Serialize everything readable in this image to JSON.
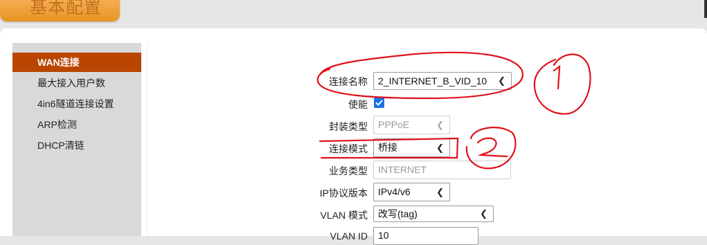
{
  "header": {
    "tab_title": "基本配置"
  },
  "sidebar": {
    "items": [
      {
        "label": "WAN连接",
        "active": true
      },
      {
        "label": "最大接入用户数",
        "active": false
      },
      {
        "label": "4in6隧道连接设置",
        "active": false
      },
      {
        "label": "ARP检测",
        "active": false
      },
      {
        "label": "DHCP清链",
        "active": false
      }
    ]
  },
  "form": {
    "connection_name": {
      "label": "连接名称",
      "value": "2_INTERNET_B_VID_10",
      "icon": "chevron-down-icon"
    },
    "enable": {
      "label": "使能",
      "checked": true,
      "icon": "checkmark-icon"
    },
    "encapsulation": {
      "label": "封装类型",
      "value": "PPPoE",
      "disabled": true,
      "icon": "chevron-down-icon"
    },
    "connection_mode": {
      "label": "连接模式",
      "value": "桥接",
      "icon": "chevron-down-icon"
    },
    "service_type": {
      "label": "业务类型",
      "value": "INTERNET",
      "disabled": true
    },
    "ip_version": {
      "label": "IP协议版本",
      "value": "IPv4/v6",
      "icon": "chevron-down-icon"
    },
    "vlan_mode": {
      "label": "VLAN 模式",
      "value": "改写(tag)",
      "icon": "chevron-down-icon"
    },
    "vlan_id": {
      "label": "VLAN ID",
      "value": "10"
    }
  },
  "annotations": {
    "color": "#e0101a",
    "marks": [
      "circled-number-1",
      "circled-number-2"
    ]
  },
  "colors": {
    "accent": "#b94500",
    "tab": "#e99424",
    "checkbox": "#1a73e8"
  }
}
